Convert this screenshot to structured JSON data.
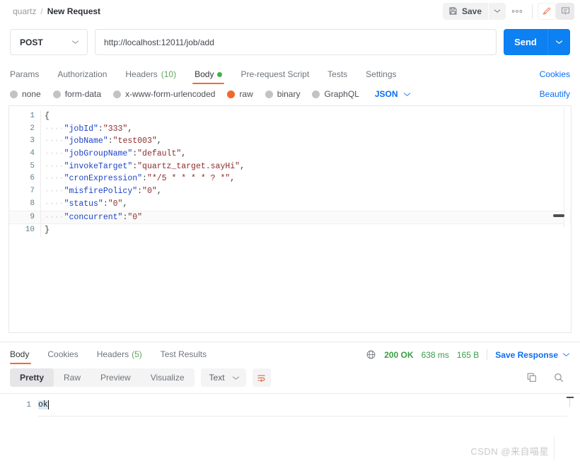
{
  "topbar": {
    "collection": "quartz",
    "separator": "/",
    "request_name": "New Request",
    "save_label": "Save",
    "more_label": "ooo",
    "edit_icon": "pencil-icon",
    "comment_icon": "comment-icon"
  },
  "url_bar": {
    "method": "POST",
    "url": "http://localhost:12011/job/add",
    "send_label": "Send"
  },
  "request_tabs": {
    "items": [
      {
        "label": "Params",
        "count": "",
        "active": false,
        "dot": false
      },
      {
        "label": "Authorization",
        "count": "",
        "active": false,
        "dot": false
      },
      {
        "label": "Headers",
        "count": "(10)",
        "active": false,
        "dot": false
      },
      {
        "label": "Body",
        "count": "",
        "active": true,
        "dot": true
      },
      {
        "label": "Pre-request Script",
        "count": "",
        "active": false,
        "dot": false
      },
      {
        "label": "Tests",
        "count": "",
        "active": false,
        "dot": false
      },
      {
        "label": "Settings",
        "count": "",
        "active": false,
        "dot": false
      }
    ],
    "cookies_label": "Cookies"
  },
  "body_type": {
    "options": [
      {
        "label": "none",
        "selected": false
      },
      {
        "label": "form-data",
        "selected": false
      },
      {
        "label": "x-www-form-urlencoded",
        "selected": false
      },
      {
        "label": "raw",
        "selected": true
      },
      {
        "label": "binary",
        "selected": false
      },
      {
        "label": "GraphQL",
        "selected": false
      }
    ],
    "format": "JSON",
    "beautify_label": "Beautify"
  },
  "editor": {
    "lines": [
      {
        "num": "1",
        "indent": "",
        "key": "",
        "colon": "",
        "value": "",
        "tail": "",
        "brace": "{"
      },
      {
        "num": "2",
        "indent": "····",
        "key": "\"jobId\"",
        "colon": ":",
        "value": "\"333\"",
        "tail": ",",
        "brace": ""
      },
      {
        "num": "3",
        "indent": "····",
        "key": "\"jobName\"",
        "colon": ":",
        "value": "\"test003\"",
        "tail": ",",
        "brace": ""
      },
      {
        "num": "4",
        "indent": "····",
        "key": "\"jobGroupName\"",
        "colon": ":",
        "value": "\"default\"",
        "tail": ",",
        "brace": ""
      },
      {
        "num": "5",
        "indent": "····",
        "key": "\"invokeTarget\"",
        "colon": ":",
        "value": "\"quartz_target.sayHi\"",
        "tail": ",",
        "brace": ""
      },
      {
        "num": "6",
        "indent": "····",
        "key": "\"cronExpression\"",
        "colon": ":",
        "value": "\"*/5 * * * * ? *\"",
        "tail": ",",
        "brace": ""
      },
      {
        "num": "7",
        "indent": "····",
        "key": "\"misfirePolicy\"",
        "colon": ":",
        "value": "\"0\"",
        "tail": ",",
        "brace": ""
      },
      {
        "num": "8",
        "indent": "····",
        "key": "\"status\"",
        "colon": ":",
        "value": "\"0\"",
        "tail": ",",
        "brace": ""
      },
      {
        "num": "9",
        "indent": "····",
        "key": "\"concurrent\"",
        "colon": ":",
        "value": "\"0\"",
        "tail": "",
        "brace": ""
      },
      {
        "num": "10",
        "indent": "",
        "key": "",
        "colon": "",
        "value": "",
        "tail": "",
        "brace": "}"
      }
    ],
    "current_line": 9
  },
  "response": {
    "tabs": [
      {
        "label": "Body",
        "count": "",
        "active": true
      },
      {
        "label": "Cookies",
        "count": "",
        "active": false
      },
      {
        "label": "Headers",
        "count": "(5)",
        "active": false
      },
      {
        "label": "Test Results",
        "count": "",
        "active": false
      }
    ],
    "status": "200 OK",
    "time": "638 ms",
    "size": "165 B",
    "save_response_label": "Save Response",
    "globe_icon": "globe-icon"
  },
  "view_toolbar": {
    "modes": [
      {
        "label": "Pretty",
        "active": true
      },
      {
        "label": "Raw",
        "active": false
      },
      {
        "label": "Preview",
        "active": false
      },
      {
        "label": "Visualize",
        "active": false
      }
    ],
    "type": "Text",
    "wrap_icon": "wrap-lines-icon",
    "copy_icon": "copy-icon",
    "search_icon": "search-icon"
  },
  "response_body": {
    "line_number": "1",
    "text": "ok"
  },
  "watermark": "CSDN @来自喵星",
  "colors": {
    "accent_orange": "#ef6c34",
    "link_blue": "#0d6ef2",
    "send_blue": "#0d80f2",
    "success_green": "#3a9e46",
    "json_key": "#1b43c8",
    "json_string": "#8d2b2b"
  }
}
